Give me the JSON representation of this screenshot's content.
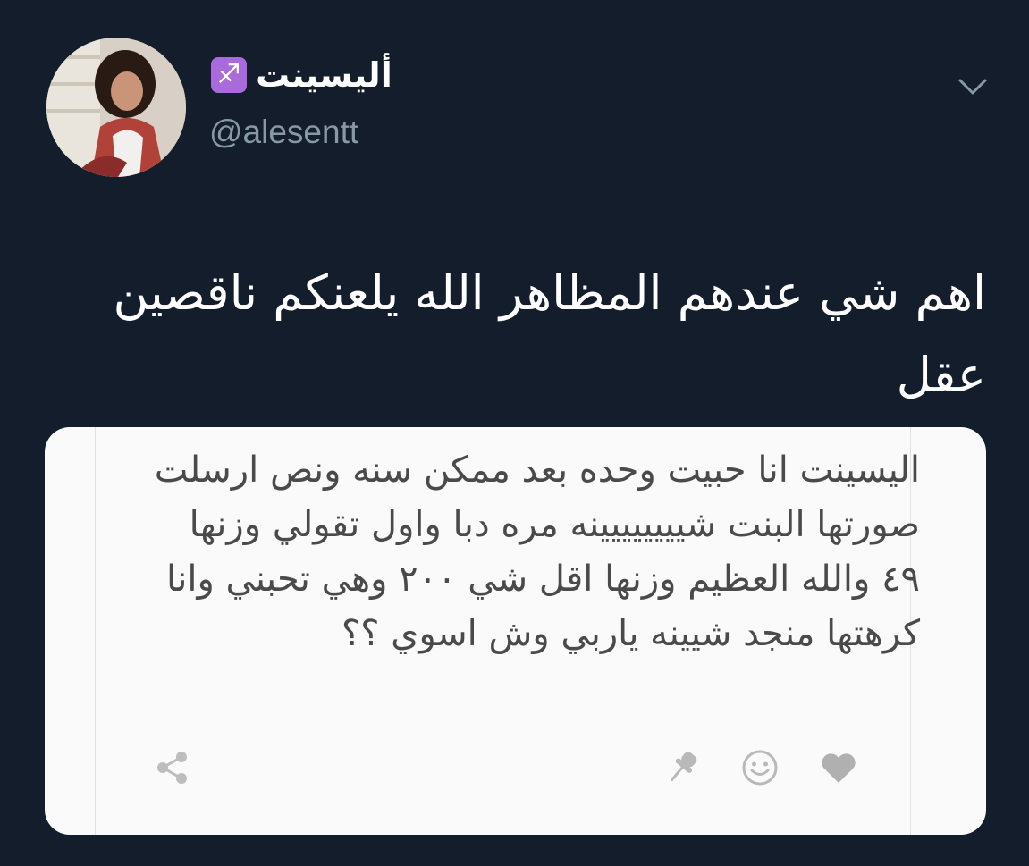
{
  "user": {
    "display_name": "أليسينت",
    "zodiac_emoji": "♐",
    "handle": "@alesentt"
  },
  "icons": {
    "menu": "chevron-down-icon",
    "share": "share-icon",
    "pin": "pin-icon",
    "reaction": "smile-icon",
    "like": "heart-icon"
  },
  "tweet": {
    "text": "اهم شي عندهم المظاهر الله يلعنكم ناقصين عقل"
  },
  "embedded_post": {
    "text": "اليسينت انا حبيت وحده بعد ممكن سنه ونص ارسلت صورتها البنت شيييييييينه مره دبا واول تقولي وزنها ٤٩ والله العظيم وزنها اقل شي ٢٠٠ وهي تحبني وانا كرهتها منجد شيينه ياربي وش اسوي ؟؟"
  },
  "colors": {
    "background": "#141d2b",
    "card": "#fafafa",
    "zodiac_badge": "#a96bdc",
    "muted": "#8899a6"
  }
}
